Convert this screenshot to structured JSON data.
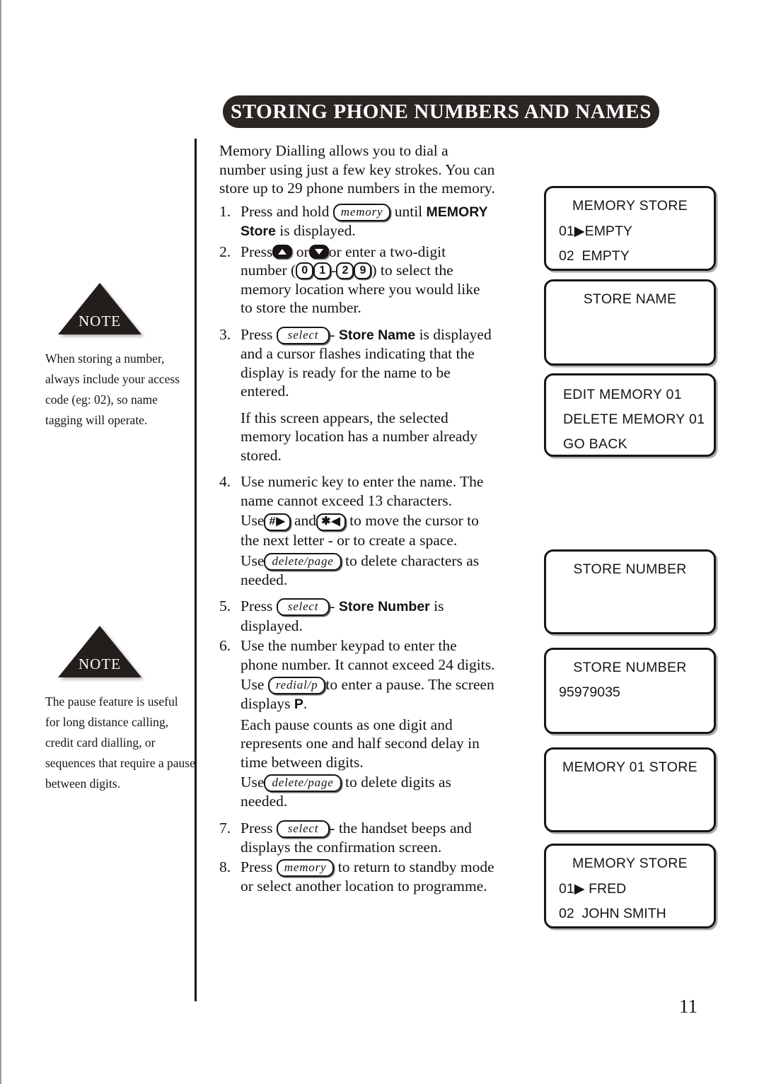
{
  "header": {
    "title": "STORING PHONE NUMBERS AND NAMES"
  },
  "page_number": "11",
  "notes": [
    {
      "label": "NOTE",
      "text": "When storing a number, always include your access code (eg: 02), so name tagging will operate."
    },
    {
      "label": "NOTE",
      "text": "The pause feature is useful for long distance calling, credit card dialling, or sequences that require a pause between digits."
    }
  ],
  "main": {
    "intro": "Memory Dialling allows you to dial a number using just a few key strokes. You can store up to 29 phone numbers in the memory.",
    "step1": {
      "num": "1.",
      "a": "Press and hold",
      "key": "memory",
      "b": "until",
      "bold1": "MEMORY",
      "bold2": "Store",
      "c": "is displayed."
    },
    "step2": {
      "num": "2.",
      "a": "Press",
      "or1": "or",
      "b": "or enter a two-digit number (",
      "d1": "0",
      "d2": "1",
      "dash": "-",
      "d3": "2",
      "d4": "9",
      "c": ") to select the memory location where you would like to store the number."
    },
    "step3": {
      "num": "3.",
      "a": "Press",
      "key": "select",
      "dash": "-",
      "bold": "Store Name",
      "b": "is displayed and a cursor flashes indicating that the display is ready for the name to be entered."
    },
    "step3note": "If this screen appears, the selected memory location has a number already stored.",
    "step4": {
      "num": "4.",
      "a": "Use numeric key to enter the name. The name cannot exceed 13 characters.",
      "b": "Use",
      "key_hash": "#▶",
      "c": "and",
      "key_star": "✱◀",
      "d": "to move the cursor to the next letter - or to create a space.",
      "e": "Use",
      "key_delete": "delete/page",
      "f": "to delete characters as needed."
    },
    "step5": {
      "num": "5.",
      "a": "Press",
      "key": "select",
      "dash": "-",
      "bold": "Store Number",
      "b": "is displayed."
    },
    "step6": {
      "num": "6.",
      "a": "Use the number keypad to enter the phone number. It cannot exceed 24 digits.",
      "b": "Use",
      "key_redial": "redial/p",
      "c": "to enter a pause. The screen displays",
      "bold_p": "P",
      "c2": ".",
      "d": "Each pause counts as one digit and represents one and half second delay in time between digits.",
      "e": "Use",
      "key_delete": "delete/page",
      "f": "to delete digits as needed."
    },
    "step7": {
      "num": "7.",
      "a": "Press",
      "key": "select",
      "b": "- the handset beeps and displays the confirmation screen."
    },
    "step8": {
      "num": "8.",
      "a": "Press",
      "key": "memory",
      "b": "to return to standby mode or select another location to programme."
    }
  },
  "screens": [
    {
      "id": "memory-store-empty",
      "title": "MEMORY STORE",
      "rows": [
        "01▶EMPTY",
        "02  EMPTY"
      ]
    },
    {
      "id": "store-name",
      "title": "STORE NAME",
      "rows": []
    },
    {
      "id": "edit-delete-menu",
      "title": "",
      "left_rows": [
        "EDIT MEMORY 01",
        "DELETE MEMORY 01",
        "GO BACK"
      ]
    },
    {
      "id": "store-number-empty",
      "title": "STORE NUMBER",
      "rows": []
    },
    {
      "id": "store-number-filled",
      "title": "STORE NUMBER",
      "rows": [
        "95979035"
      ]
    },
    {
      "id": "memory-01-store",
      "title": "MEMORY 01 STORE",
      "rows": []
    },
    {
      "id": "memory-store-filled",
      "title": "MEMORY STORE",
      "rows": [
        "01▶ FRED",
        "02  JOHN SMITH"
      ]
    }
  ]
}
